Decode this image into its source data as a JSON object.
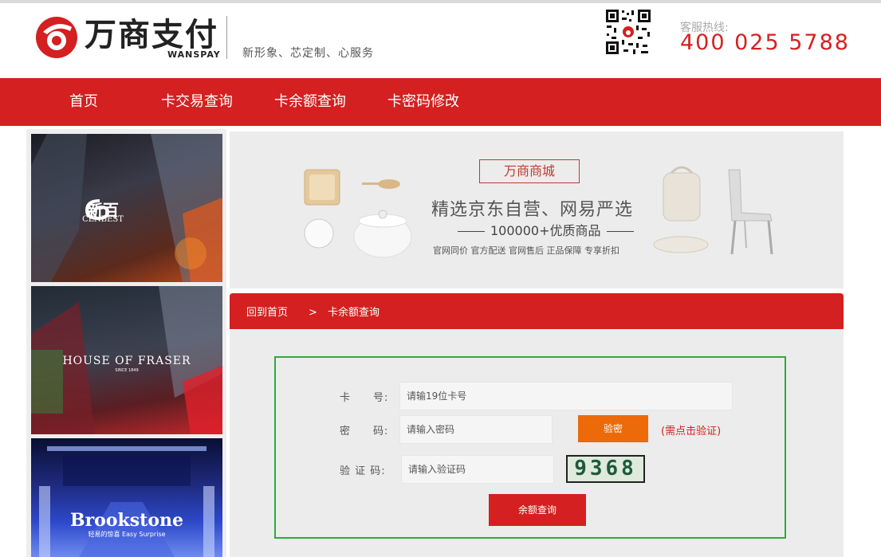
{
  "header": {
    "logo_cn": "万商支付",
    "logo_en": "WANSPAY",
    "slogan": "新形象、芯定制、心服务",
    "hotline_label": "客服热线:",
    "hotline_number": "400 025 5788"
  },
  "nav": {
    "items": [
      "首页",
      "卡交易查询",
      "卡余额查询",
      "卡密码修改"
    ]
  },
  "sidebar": {
    "stores": [
      {
        "name": "新百",
        "sub": "CENBEST"
      },
      {
        "name": "HOUSE OF FRASER",
        "sub": "SINCE 1849"
      },
      {
        "name": "Brookstone",
        "sub": "轻易的惊喜 Easy Surprise"
      }
    ]
  },
  "banner": {
    "tag": "万商商城",
    "title": "精选京东自营、网易严选",
    "subtitle": "100000+优质商品",
    "features": "官网同价  官方配送  官网售后 正品保障 专享折扣"
  },
  "panel": {
    "crumb_home": "回到首页",
    "crumb_sep": ">",
    "crumb_current": "卡余额查询",
    "card_label": "卡　　号:",
    "card_placeholder": "请输19位卡号",
    "password_label": "密　　码:",
    "password_placeholder": "请输入密码",
    "verify_button": "验密",
    "verify_hint": "(需点击验证)",
    "captcha_label": "验 证 码:",
    "captcha_placeholder": "请输入验证码",
    "captcha_value": "9368",
    "query_button": "余额查询"
  },
  "colors": {
    "brand_red": "#d42020",
    "verify_orange": "#ec6a0a",
    "form_border_green": "#2bab3d"
  }
}
